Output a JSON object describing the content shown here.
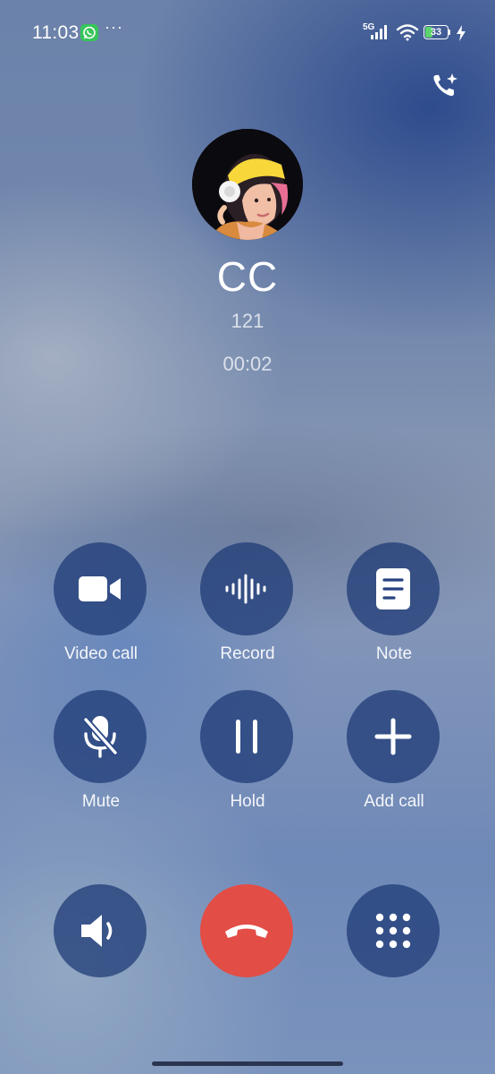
{
  "status_bar": {
    "time": "11:03",
    "notification_icons": [
      "whatsapp-icon"
    ],
    "more_indicator": "···",
    "network_type": "5G",
    "battery_level": "33",
    "battery_fraction": 0.33,
    "charging": true,
    "accent_battery_color": "#5cd36c"
  },
  "top_actions": {
    "smart_call_icon": "phone-sparkle-icon"
  },
  "caller": {
    "name": "CC",
    "number": "121",
    "duration": "00:02",
    "avatar": "avatar-photo"
  },
  "controls": [
    {
      "label": "Video call",
      "icon": "video-camera-icon"
    },
    {
      "label": "Record",
      "icon": "waveform-icon"
    },
    {
      "label": "Note",
      "icon": "note-icon"
    },
    {
      "label": "Mute",
      "icon": "mic-off-icon"
    },
    {
      "label": "Hold",
      "icon": "pause-icon"
    },
    {
      "label": "Add call",
      "icon": "plus-icon"
    }
  ],
  "bottom_actions": {
    "speaker_icon": "speaker-icon",
    "hangup_icon": "phone-hangup-icon",
    "keypad_icon": "keypad-icon",
    "hangup_color": "#e24d45",
    "button_color": "#1e3a76"
  }
}
